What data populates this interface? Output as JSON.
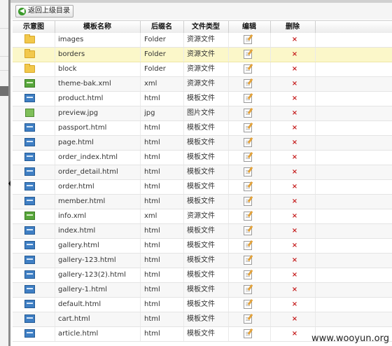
{
  "toolbar": {
    "back_label": "返回上级目录"
  },
  "columns": {
    "preview": "示意图",
    "name": "模板名称",
    "suffix": "后缀名",
    "type": "文件类型",
    "edit": "编辑",
    "delete": "删除"
  },
  "delete_glyph": "×",
  "rows": [
    {
      "icon": "folder-icon",
      "name": "images",
      "suffix": "Folder",
      "type": "资源文件"
    },
    {
      "icon": "folder-icon",
      "name": "borders",
      "suffix": "Folder",
      "type": "资源文件",
      "selected": true
    },
    {
      "icon": "folder-icon",
      "name": "block",
      "suffix": "Folder",
      "type": "资源文件"
    },
    {
      "icon": "xml-icon",
      "name": "theme-bak.xml",
      "suffix": "xml",
      "type": "资源文件"
    },
    {
      "icon": "html-icon",
      "name": "product.html",
      "suffix": "html",
      "type": "模板文件"
    },
    {
      "icon": "image-icon",
      "name": "preview.jpg",
      "suffix": "jpg",
      "type": "图片文件"
    },
    {
      "icon": "html-icon",
      "name": "passport.html",
      "suffix": "html",
      "type": "模板文件"
    },
    {
      "icon": "html-icon",
      "name": "page.html",
      "suffix": "html",
      "type": "模板文件"
    },
    {
      "icon": "html-icon",
      "name": "order_index.html",
      "suffix": "html",
      "type": "模板文件"
    },
    {
      "icon": "html-icon",
      "name": "order_detail.html",
      "suffix": "html",
      "type": "模板文件"
    },
    {
      "icon": "html-icon",
      "name": "order.html",
      "suffix": "html",
      "type": "模板文件"
    },
    {
      "icon": "html-icon",
      "name": "member.html",
      "suffix": "html",
      "type": "模板文件"
    },
    {
      "icon": "xml-icon",
      "name": "info.xml",
      "suffix": "xml",
      "type": "资源文件"
    },
    {
      "icon": "html-icon",
      "name": "index.html",
      "suffix": "html",
      "type": "模板文件"
    },
    {
      "icon": "html-icon",
      "name": "gallery.html",
      "suffix": "html",
      "type": "模板文件"
    },
    {
      "icon": "html-icon",
      "name": "gallery-123.html",
      "suffix": "html",
      "type": "模板文件"
    },
    {
      "icon": "html-icon",
      "name": "gallery-123(2).html",
      "suffix": "html",
      "type": "模板文件"
    },
    {
      "icon": "html-icon",
      "name": "gallery-1.html",
      "suffix": "html",
      "type": "模板文件"
    },
    {
      "icon": "html-icon",
      "name": "default.html",
      "suffix": "html",
      "type": "模板文件"
    },
    {
      "icon": "html-icon",
      "name": "cart.html",
      "suffix": "html",
      "type": "模板文件"
    },
    {
      "icon": "html-icon",
      "name": "article.html",
      "suffix": "html",
      "type": "模板文件"
    }
  ],
  "watermark": "www.wooyun.org"
}
